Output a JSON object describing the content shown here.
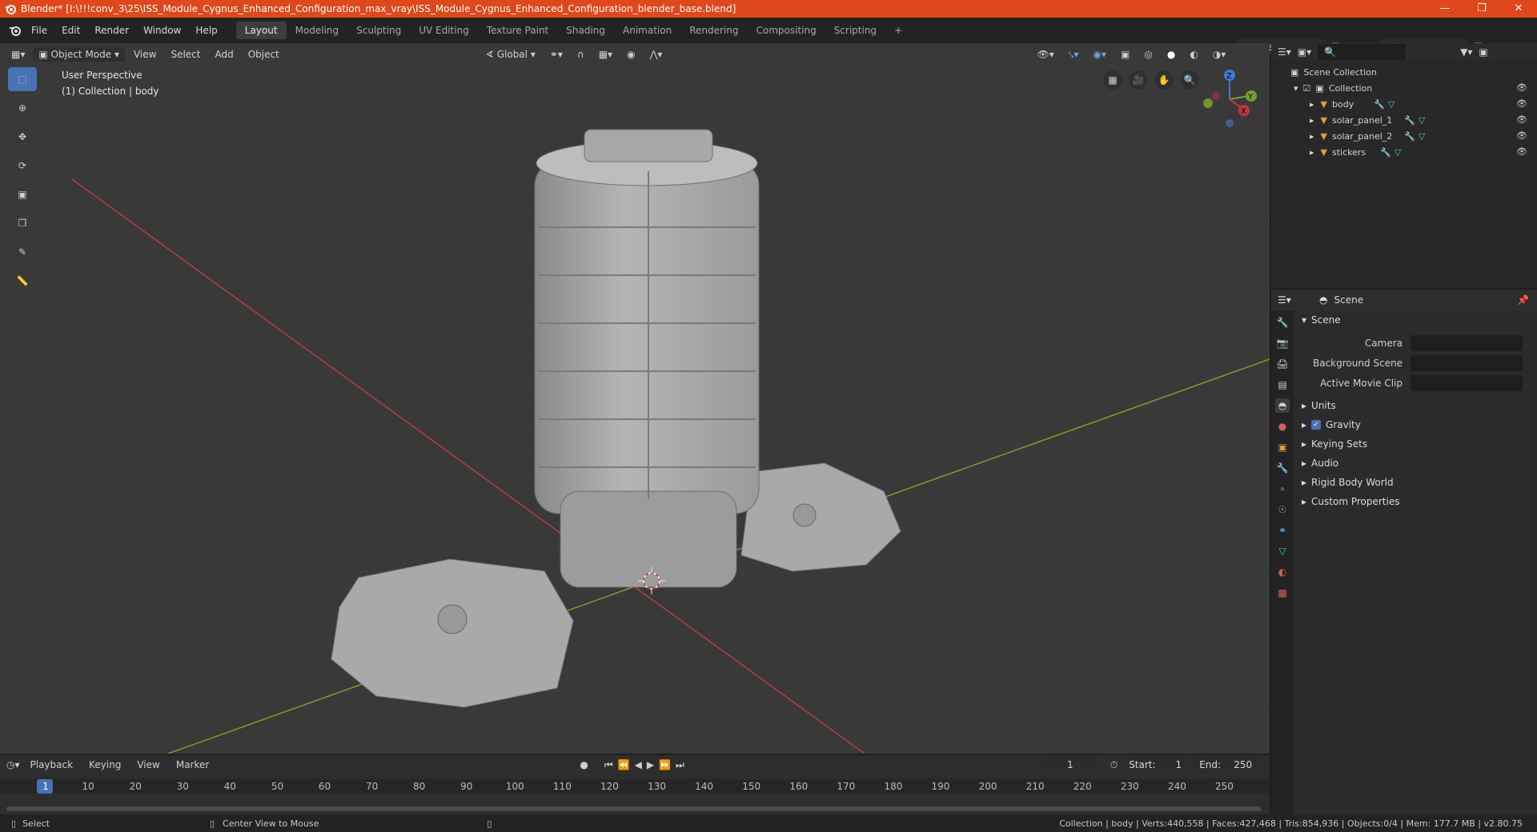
{
  "window": {
    "title": "Blender* [I:\\!!!conv_3\\25\\ISS_Module_Cygnus_Enhanced_Configuration_max_vray\\ISS_Module_Cygnus_Enhanced_Configuration_blender_base.blend]"
  },
  "menu": [
    "File",
    "Edit",
    "Render",
    "Window",
    "Help"
  ],
  "workspaces": [
    "Layout",
    "Modeling",
    "Sculpting",
    "UV Editing",
    "Texture Paint",
    "Shading",
    "Animation",
    "Rendering",
    "Compositing",
    "Scripting"
  ],
  "workspace_active": "Layout",
  "scene_field": "Scene",
  "viewlayer_field": "View Layer",
  "viewport": {
    "mode": "Object Mode",
    "menus": [
      "View",
      "Select",
      "Add",
      "Object"
    ],
    "orientation": "Global",
    "info_line1": "User Perspective",
    "info_line2": "(1) Collection | body"
  },
  "outliner": {
    "root": "Scene Collection",
    "collection": "Collection",
    "items": [
      "body",
      "solar_panel_1",
      "solar_panel_2",
      "stickers"
    ]
  },
  "properties": {
    "header": "Scene",
    "section": "Scene",
    "camera_label": "Camera",
    "bg_scene_label": "Background Scene",
    "movie_clip_label": "Active Movie Clip",
    "subsections": [
      "Units",
      "Gravity",
      "Keying Sets",
      "Audio",
      "Rigid Body World",
      "Custom Properties"
    ]
  },
  "timeline": {
    "menus": [
      "Playback",
      "Keying",
      "View",
      "Marker"
    ],
    "current_frame": "1",
    "start_label": "Start:",
    "start_value": "1",
    "end_label": "End:",
    "end_value": "250",
    "ruler": [
      "1",
      "10",
      "20",
      "30",
      "40",
      "50",
      "60",
      "70",
      "80",
      "90",
      "100",
      "110",
      "120",
      "130",
      "140",
      "150",
      "160",
      "170",
      "180",
      "190",
      "200",
      "210",
      "220",
      "230",
      "240",
      "250"
    ]
  },
  "status": {
    "left": "Select",
    "middle": "Center View to Mouse",
    "right": "Collection | body | Verts:440,558 | Faces:427,468 | Tris:854,936 | Objects:0/4 | Mem: 177.7 MB | v2.80.75"
  },
  "colors": {
    "titlebar": "#e0471a",
    "accent": "#4772b3",
    "x_axis": "#c2383b",
    "y_axis": "#7aa02c",
    "z_axis": "#3a7ad8"
  }
}
